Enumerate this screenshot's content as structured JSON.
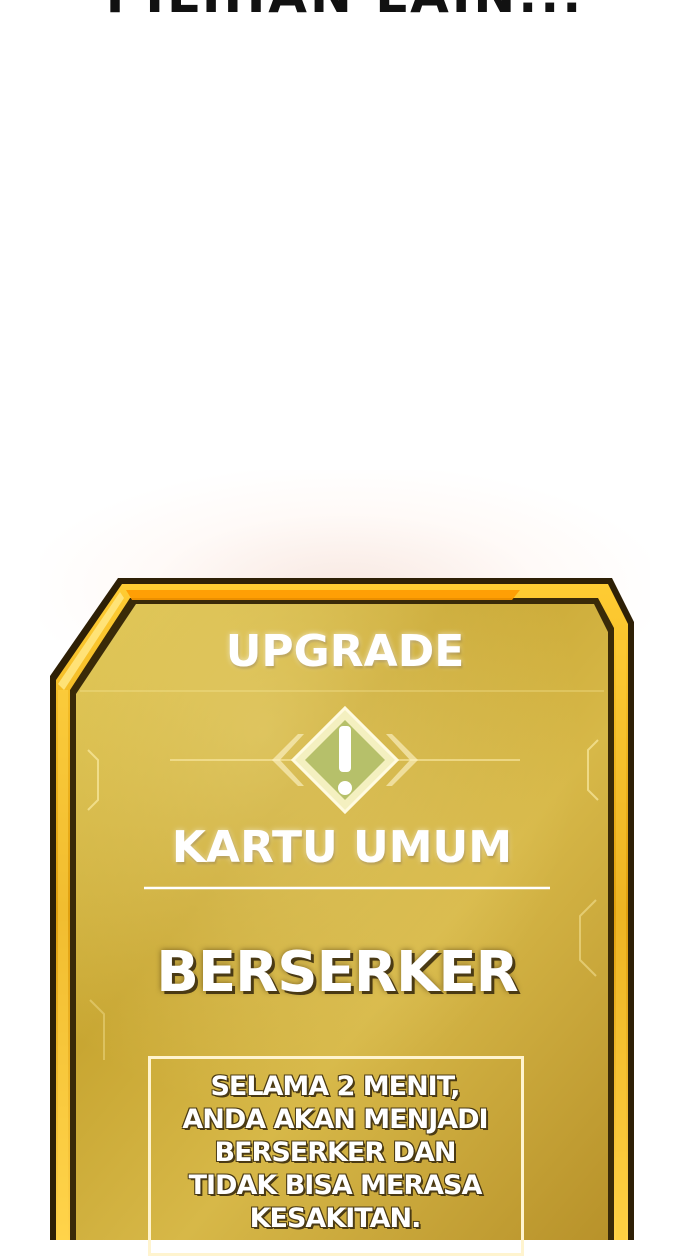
{
  "caption": {
    "text": "PILIHAN LAIN..."
  },
  "card": {
    "header": "UPGRADE",
    "icon": "warning-exclamation-icon",
    "category": "KARTU UMUM",
    "name": "BERSERKER",
    "description_lines": [
      "SELAMA 2 MENIT,",
      "ANDA AKAN MENJADI",
      "BERSERKER DAN",
      "TIDAK BISA MERASA",
      "KESAKITAN."
    ],
    "colors": {
      "gold_light": "#f3d25a",
      "gold_mid": "#c9a227",
      "gold_dark": "#8a6a12",
      "frame_dark": "#3a2a08",
      "frame_bright": "#ffb300"
    }
  }
}
